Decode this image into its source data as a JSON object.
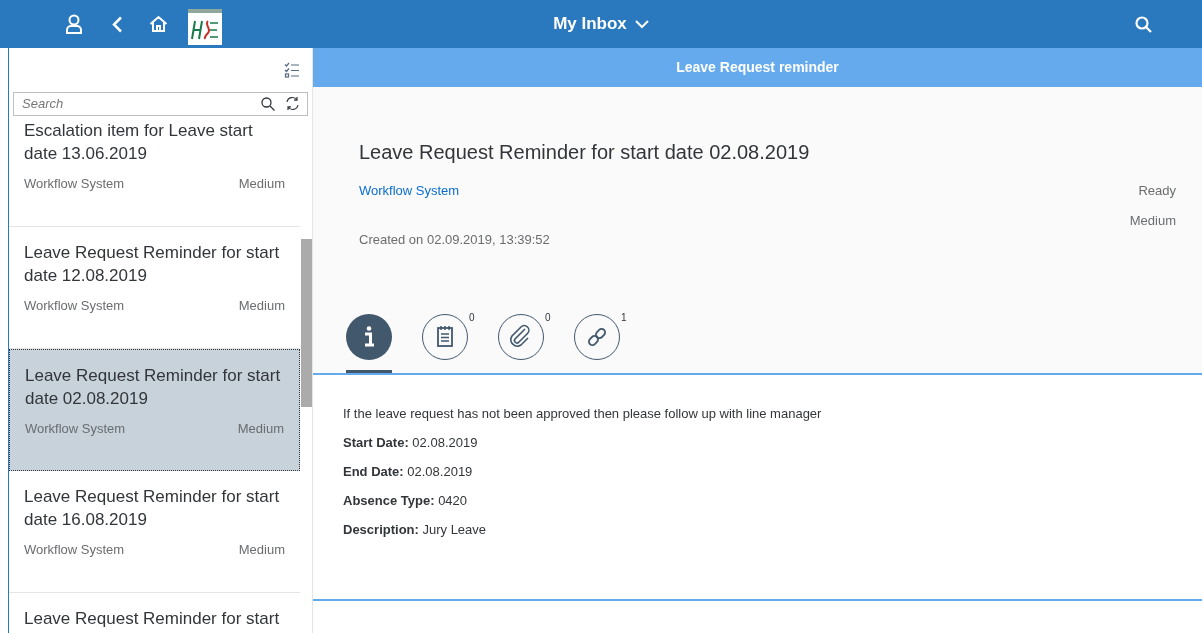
{
  "shell": {
    "title": "My Inbox"
  },
  "master": {
    "search": {
      "placeholder": "Search"
    },
    "items": [
      {
        "title": "Escalation item for Leave start date 13.06.2019",
        "creator": "Workflow System",
        "priority": "Medium",
        "selected": false
      },
      {
        "title": "Leave Request Reminder for start date 12.08.2019",
        "creator": "Workflow System",
        "priority": "Medium",
        "selected": false
      },
      {
        "title": "Leave Request Reminder for start date 02.08.2019",
        "creator": "Workflow System",
        "priority": "Medium",
        "selected": true
      },
      {
        "title": "Leave Request Reminder for start date 16.08.2019",
        "creator": "Workflow System",
        "priority": "Medium",
        "selected": false
      },
      {
        "title": "Leave Request Reminder for start",
        "selected": false
      }
    ]
  },
  "detail": {
    "header": "Leave Request reminder",
    "title": "Leave Request Reminder for start date 02.08.2019",
    "creator": "Workflow System",
    "status": "Ready",
    "priority": "Medium",
    "created": "Created on 02.09.2019, 13:39:52",
    "tabs": [
      {
        "kind": "info",
        "selected": true
      },
      {
        "kind": "notes",
        "count": "0",
        "selected": false
      },
      {
        "kind": "attachments",
        "count": "0",
        "selected": false
      },
      {
        "kind": "links",
        "count": "1",
        "selected": false
      }
    ],
    "description": "If the leave request has not been approved then please follow up with line manager",
    "fields": [
      {
        "label": "Start Date:",
        "value": "02.08.2019"
      },
      {
        "label": "End Date:",
        "value": "02.08.2019"
      },
      {
        "label": "Absence Type:",
        "value": "0420"
      },
      {
        "label": "Description:",
        "value": "Jury Leave"
      }
    ]
  }
}
